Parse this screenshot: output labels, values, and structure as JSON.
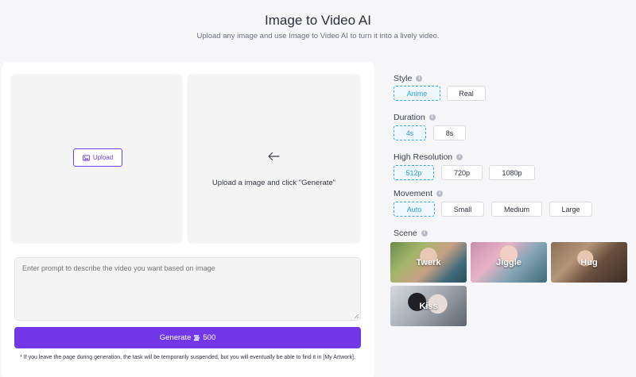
{
  "header": {
    "title": "Image to Video AI",
    "subtitle": "Upload any image and use Image to Video AI to turn it into a lively video."
  },
  "left": {
    "upload_label": "Upload",
    "hint": "Upload a image and click \"Generate\"",
    "prompt_placeholder": "Enter prompt to describe the video you want based on image",
    "generate_label": "Generate",
    "generate_cost": "500",
    "note": "* If you leave the page during generation, the task will be temporarily suspended, but you will eventually be able to find it in [My Artwork]."
  },
  "settings": {
    "style": {
      "label": "Style",
      "options": [
        "Anime",
        "Real"
      ],
      "selected": "Anime"
    },
    "duration": {
      "label": "Duration",
      "options": [
        "4s",
        "8s"
      ],
      "selected": "4s"
    },
    "resolution": {
      "label": "High Resolution",
      "options": [
        "512p",
        "720p",
        "1080p"
      ],
      "selected": "512p"
    },
    "movement": {
      "label": "Movement",
      "options": [
        "Auto",
        "Small",
        "Medium",
        "Large"
      ],
      "selected": "Auto"
    },
    "scene": {
      "label": "Scene",
      "items": [
        "Twerk",
        "Jiggle",
        "Hug",
        "Kiss"
      ]
    }
  },
  "colors": {
    "accent": "#7137e8",
    "selected_border": "#3fa3e3",
    "page_bg": "#f6f6f8"
  },
  "icons": {
    "upload": "image-icon",
    "arrow": "arrow-left-icon",
    "info": "info-icon",
    "cost": "coin-stack-icon"
  }
}
